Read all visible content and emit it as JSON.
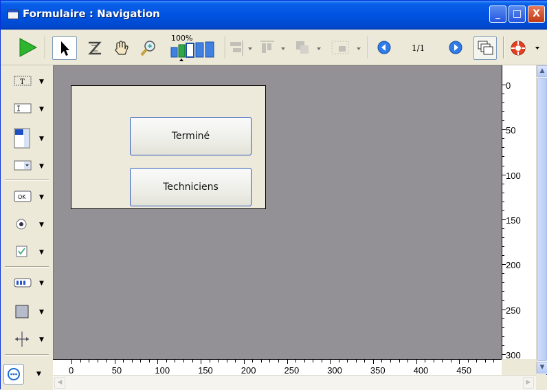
{
  "window": {
    "title": "Formulaire : Navigation",
    "minimize_label": "_",
    "maximize_label": "□",
    "close_label": "X"
  },
  "toolbar": {
    "zoom_label": "100%",
    "page_indicator": "1/1"
  },
  "form": {
    "buttons": [
      {
        "label": "Terminé"
      },
      {
        "label": "Techniciens"
      }
    ]
  },
  "rulers": {
    "vertical_labels": [
      "0",
      "50",
      "100",
      "150",
      "200",
      "250",
      "300"
    ],
    "horizontal_labels": [
      "0",
      "50",
      "100",
      "150",
      "200",
      "250",
      "300",
      "350",
      "400",
      "450"
    ]
  },
  "colors": {
    "title_bar": "#0053e1",
    "canvas_background": "#949196",
    "form_background": "#ede9db",
    "button_border": "#2c58b8",
    "run_arrow": "#2db52d"
  },
  "icons": {
    "run": "play-icon",
    "select": "arrow-cursor-icon",
    "order": "z-order-icon",
    "hand": "hand-icon",
    "zoom": "magnifier-icon",
    "prev": "previous-page-icon",
    "next": "next-page-icon",
    "layers": "layers-icon",
    "debug": "lifebuoy-icon"
  }
}
